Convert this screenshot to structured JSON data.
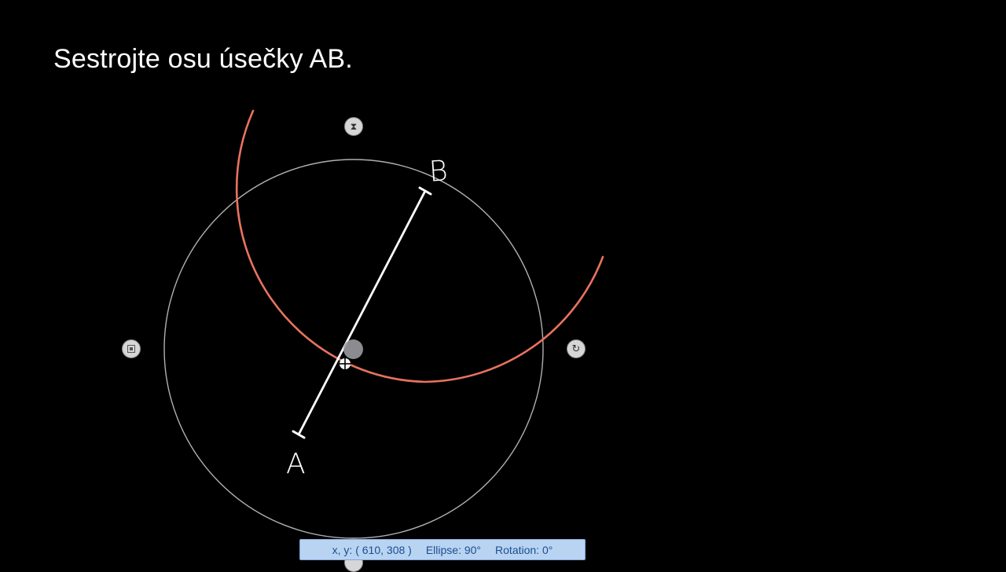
{
  "slide": {
    "title": "Sestrojte osu úsečky AB."
  },
  "points": {
    "a_label": "A",
    "b_label": "B"
  },
  "status_bar": {
    "coords_label": "x, y: ( 610, 308 )",
    "ellipse_label": "Ellipse: 90°",
    "rotation_label": "Rotation: 0°"
  },
  "colors": {
    "background": "#000000",
    "arc": "#e8735f",
    "circle": "#b0b0b0",
    "segment": "#ffffff",
    "status_bg": "#b9d3f2",
    "status_text": "#1a4f8f"
  },
  "icons": {
    "top_handle": "hourglass-icon",
    "left_handle": "square-icon",
    "right_handle": "rotate-icon",
    "bottom_handle": "circle-handle-icon"
  }
}
